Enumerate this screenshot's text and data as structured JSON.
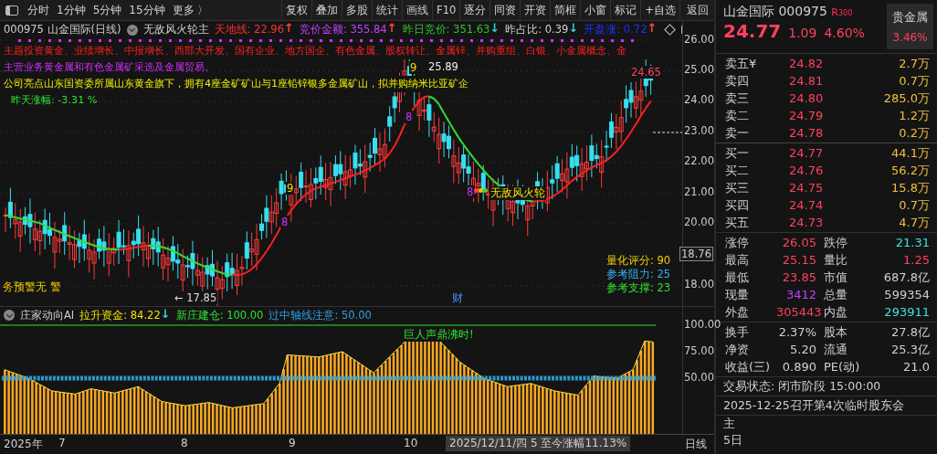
{
  "toolbar": {
    "periods": [
      "分时",
      "1分钟",
      "5分钟",
      "15分钟",
      "更多 〉"
    ],
    "buttons": [
      "复权",
      "叠加",
      "多股",
      "统计",
      "画线",
      "F10",
      "逐分",
      "同资",
      "开资",
      "简框",
      "小窗",
      "标记",
      "+自选"
    ],
    "back": "返回"
  },
  "chart_header": {
    "code": "000975",
    "name": "山金国际(日线)",
    "indicator": "无敌风火轮主",
    "metrics": [
      {
        "label": "天地线: 22.96",
        "color": "#ff3030",
        "arrow": {
          "text": "↑",
          "color": "#ff4040"
        }
      },
      {
        "label": "竞价金额: 355.84",
        "color": "#c040ff",
        "arrow": {
          "text": "↑",
          "color": "#ff4040"
        }
      },
      {
        "label": "昨日竞价: 351.63",
        "color": "#30c030",
        "arrow": {
          "text": "↓",
          "color": "#30d0e0"
        }
      },
      {
        "label": "昨占比: 0.39",
        "color": "#d0d0d0",
        "arrow": {
          "text": "↓",
          "color": "#30d0e0"
        }
      },
      {
        "label": "开盘涨: 0.72",
        "color": "#2030ff",
        "arrow": {
          "text": "↑",
          "color": "#ff4040"
        }
      }
    ]
  },
  "info_lines": [
    {
      "text": "主题投资黄金、业绩增长、中报增长、西部大开发、国有企业、地方国企、有色金属、股权转让、金属锌、并购重组、白银、小金属概念、金",
      "color": "#ff2020"
    },
    {
      "text": "主营业务黄金属和有色金属矿采选及金属贸易。",
      "color": "#d030ff"
    },
    {
      "text": "公司亮点山东国资委所属山东黄金旗下，拥有4座金矿矿山与1座铅锌银多金属矿山，拟并购纳米比亚矿企",
      "color": "#f0f000"
    },
    {
      "text": "昨天涨幅: -3.31 %",
      "color": "#30e030"
    }
  ],
  "price_axis": [
    "26.00",
    "25.00",
    "24.00",
    "23.00",
    "22.00",
    "21.00",
    "20.00",
    "18.00"
  ],
  "current_price": "18.76",
  "chart_labels": {
    "high": "25.89",
    "recent_high": "24.65",
    "low": "← 17.85",
    "nine_marks": [
      "9",
      "9"
    ],
    "eight_marks": [
      "8",
      "8",
      "8"
    ],
    "signal": "无敌风火轮",
    "finance": "财",
    "warning": "务预警无 警"
  },
  "side_scores": [
    {
      "text": "量化评分: 90",
      "color": "#f0d000"
    },
    {
      "text": "参考阻力: 25",
      "color": "#30b0f0"
    },
    {
      "text": "参考支撑: 23",
      "color": "#30e030"
    }
  ],
  "indicator": {
    "title": "庄家动向AI",
    "metrics": [
      {
        "label": "拉升资金: 84.22",
        "arrow": "↓",
        "color": "#f0e000"
      },
      {
        "label": "新庄建仓: 100.00",
        "color": "#30e030"
      },
      {
        "label": "过中轴线注意: 50.00",
        "color": "#30a0e0"
      }
    ],
    "axis": [
      "100.00",
      "75.00",
      "50.00"
    ],
    "note": "巨人声鼎沸时!"
  },
  "date_axis": {
    "labels": [
      "2025年",
      "7",
      "8",
      "9",
      "10"
    ],
    "cursor": "2025/12/11/四 5 至今涨幅11.13%",
    "period": "日线"
  },
  "quote": {
    "name": "山金国际",
    "code": "000975",
    "r_mark": "R",
    "r_value": "300",
    "sector": "贵金属",
    "sector_change": "3.46%",
    "price": "24.77",
    "change": "1.09",
    "change_pct": "4.60%",
    "sell": [
      {
        "label": "卖五",
        "extra": "¥",
        "price": "24.82",
        "volume": "2.7万"
      },
      {
        "label": "卖四",
        "price": "24.81",
        "volume": "0.7万"
      },
      {
        "label": "卖三",
        "price": "24.80",
        "volume": "285.0万"
      },
      {
        "label": "卖二",
        "price": "24.79",
        "volume": "1.2万"
      },
      {
        "label": "卖一",
        "price": "24.78",
        "volume": "0.2万"
      }
    ],
    "buy": [
      {
        "label": "买一",
        "price": "24.77",
        "volume": "44.1万"
      },
      {
        "label": "买二",
        "price": "24.76",
        "volume": "56.2万"
      },
      {
        "label": "买三",
        "price": "24.75",
        "volume": "15.8万"
      },
      {
        "label": "买四",
        "price": "24.74",
        "volume": "0.7万"
      },
      {
        "label": "买五",
        "price": "24.73",
        "volume": "4.7万"
      }
    ],
    "stats": [
      [
        {
          "label": "涨停",
          "value": "26.05",
          "color": "#ff4060"
        },
        {
          "label": "跌停",
          "value": "21.31",
          "color": "#40e0e0"
        }
      ],
      [
        {
          "label": "最高",
          "value": "25.15",
          "color": "#ff4060"
        },
        {
          "label": "量比",
          "value": "1.25",
          "color": "#ff4060"
        }
      ],
      [
        {
          "label": "最低",
          "value": "23.85",
          "color": "#ff4060"
        },
        {
          "label": "市值",
          "value": "687.8亿",
          "color": "#d0d0d0"
        }
      ],
      [
        {
          "label": "现量",
          "value": "3412",
          "color": "#c040ff"
        },
        {
          "label": "总量",
          "value": "599354",
          "color": "#d0d0d0"
        }
      ],
      [
        {
          "label": "外盘",
          "value": "305443",
          "color": "#ff4060"
        },
        {
          "label": "内盘",
          "value": "293911",
          "color": "#40e0e0"
        }
      ]
    ],
    "stats2": [
      [
        {
          "label": "换手",
          "value": "2.37%",
          "color": "#d0d0d0"
        },
        {
          "label": "股本",
          "value": "27.8亿",
          "color": "#d0d0d0"
        }
      ],
      [
        {
          "label": "净资",
          "value": "5.20",
          "color": "#d0d0d0"
        },
        {
          "label": "流通",
          "value": "25.3亿",
          "color": "#d0d0d0"
        }
      ],
      [
        {
          "label": "收益(三)",
          "value": "0.890",
          "color": "#d0d0d0"
        },
        {
          "label": "PE(动)",
          "value": "21.0",
          "color": "#d0d0d0"
        }
      ]
    ],
    "status": "交易状态: 闭市阶段 15:00:00",
    "notice": "2025-12-25召开第4次临时股东会",
    "more": [
      "主",
      "5日"
    ]
  }
}
